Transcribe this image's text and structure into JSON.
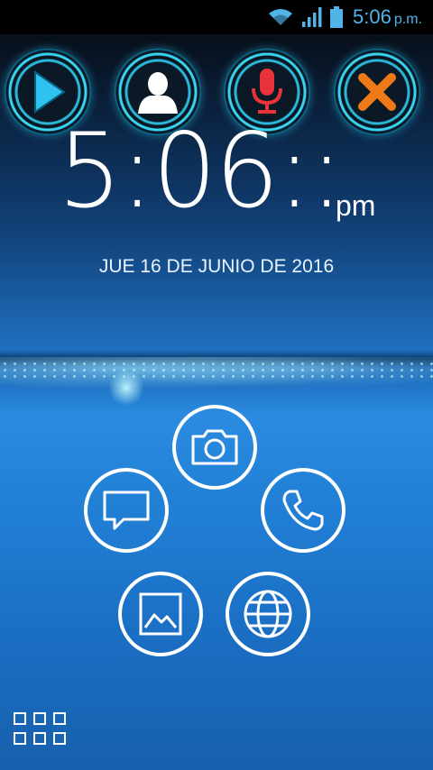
{
  "status_bar": {
    "time": "5:06",
    "ampm": "p.m.",
    "icons": [
      "wifi-icon",
      "signal-icon",
      "battery-icon"
    ],
    "color": "#4fb4e6"
  },
  "quick_actions": [
    {
      "name": "play",
      "icon": "play-icon",
      "color": "#28b8e8"
    },
    {
      "name": "contact",
      "icon": "person-icon",
      "color": "#ffffff"
    },
    {
      "name": "voice",
      "icon": "microphone-icon",
      "color": "#e8333b"
    },
    {
      "name": "close",
      "icon": "close-icon",
      "color": "#f07a18"
    }
  ],
  "clock": {
    "time": "5:06::",
    "ampm": "pm"
  },
  "date": "JUE 16 DE JUNIO DE 2016",
  "apps": [
    {
      "name": "camera",
      "icon": "camera-icon"
    },
    {
      "name": "messages",
      "icon": "message-icon"
    },
    {
      "name": "phone",
      "icon": "phone-icon"
    },
    {
      "name": "gallery",
      "icon": "gallery-icon"
    },
    {
      "name": "browser",
      "icon": "globe-icon"
    }
  ],
  "app_drawer": {
    "icon": "app-grid-icon"
  }
}
